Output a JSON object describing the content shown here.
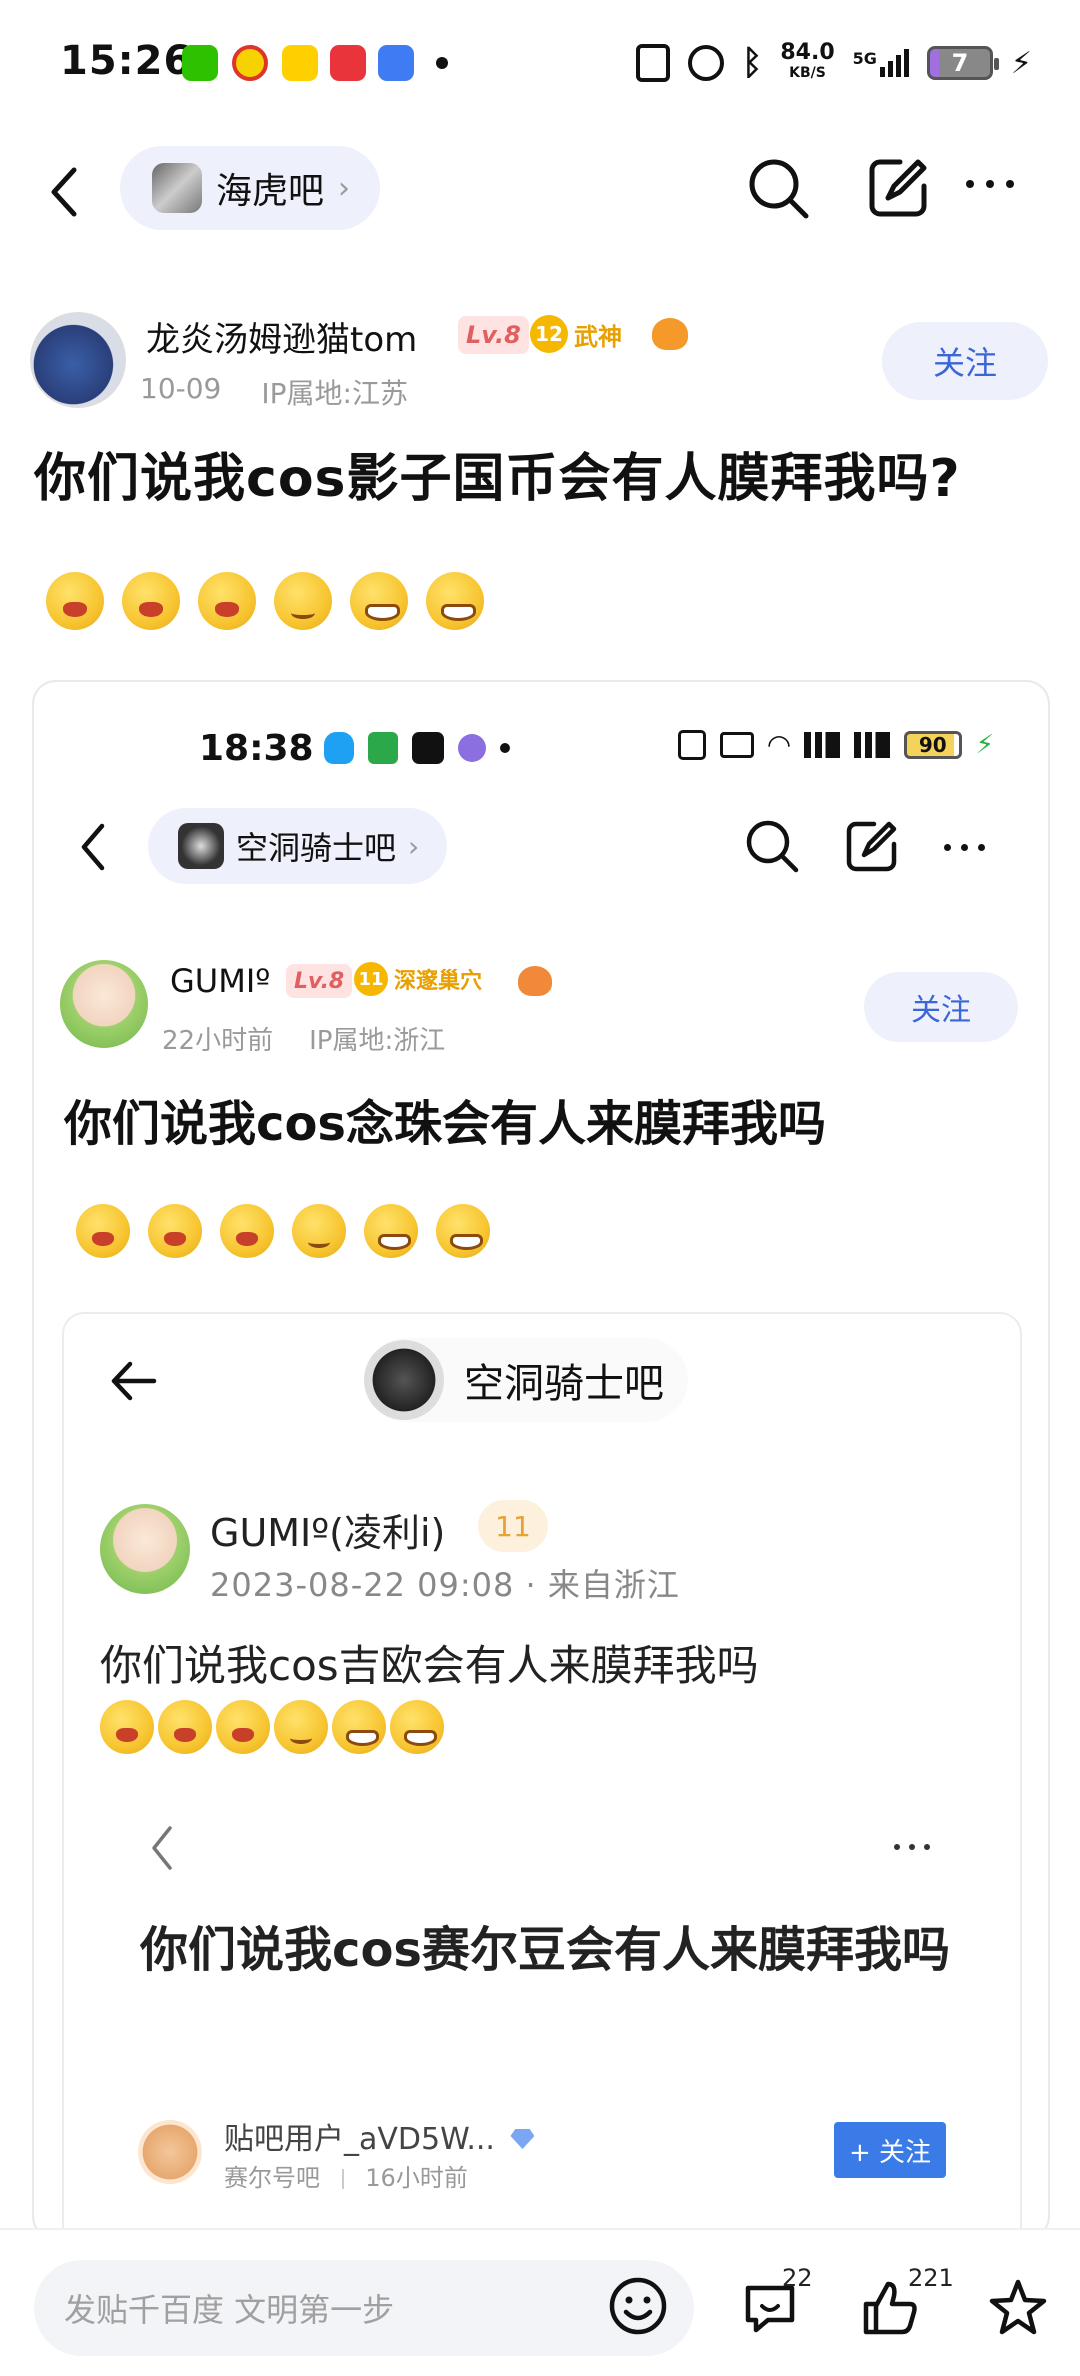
{
  "status_bar": {
    "time": "15:26",
    "net_speed": "84.0",
    "net_unit": "KB/S",
    "signal": "5G",
    "battery": "7",
    "app_icons": [
      "wechat-icon",
      "weibo-icon",
      "meituan-icon",
      "taobao-icon",
      "cloud-icon"
    ]
  },
  "nav": {
    "forum_name": "海虎吧"
  },
  "post": {
    "username": "龙炎汤姆逊猫tom",
    "level": "Lv.8",
    "honor_level": "12",
    "honor_title": "武神",
    "date": "10-09",
    "ip_location": "IP属地:江苏",
    "follow_label": "关注",
    "title": "你们说我cos影子国币会有人膜拜我吗?"
  },
  "embedded_1": {
    "status_time": "18:38",
    "battery": "90",
    "forum_name": "空洞骑士吧",
    "username": "GUMIº",
    "level": "Lv.8",
    "honor_level": "11",
    "honor_title": "深邃巢穴",
    "time_ago": "22小时前",
    "ip_location": "IP属地:浙江",
    "follow_label": "关注",
    "title": "你们说我cos念珠会有人来膜拜我吗"
  },
  "embedded_2": {
    "forum_name": "空洞骑士吧",
    "username": "GUMIº(凌利i)",
    "level": "11",
    "meta": "2023-08-22 09:08 · 来自浙江",
    "text": "你们说我cos吉欧会有人来膜拜我吗"
  },
  "embedded_3": {
    "title": "你们说我cos赛尔豆会有人来膜拜我吗",
    "username": "贴吧用户_aVD5W...",
    "forum": "赛尔号吧",
    "time_ago": "16小时前",
    "follow_label": "+ 关注"
  },
  "bottom_bar": {
    "placeholder": "发贴千百度 文明第一步",
    "comment_count": "22",
    "like_count": "221"
  },
  "colors": {
    "accent_blue": "#3a66d8",
    "pill_bg": "#eef1fb",
    "honor_gold": "#e8a000"
  }
}
